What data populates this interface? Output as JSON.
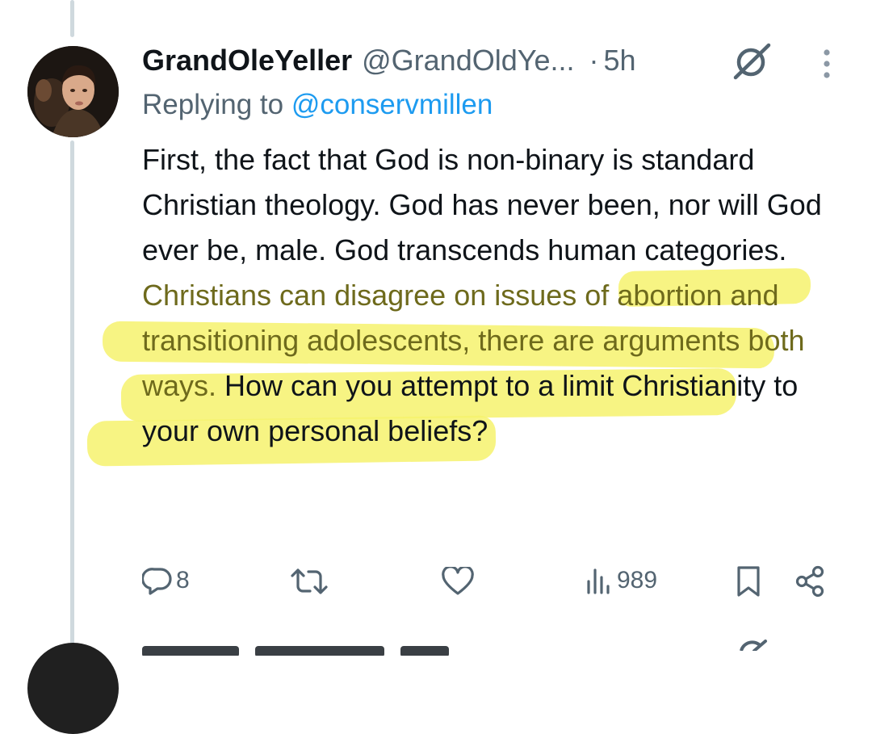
{
  "tweet": {
    "display_name": "GrandOleYeller",
    "handle": "@GrandOldYe...",
    "separator": "·",
    "time": "5h",
    "replying_prefix": "Replying to ",
    "replying_mention": "@conservmillen",
    "body_part1": "First, the fact that God is non-binary is standard Christian theology.  God has never been, nor will God ever be, male.  God transcends human categories.  ",
    "body_highlight": "Christians can disagree on issues of abortion and transitioning adolescents, there are arguments both ways.",
    "body_part2": "  How can you attempt to a limit Christianity to your own personal beliefs?",
    "highlight_color": "#f6f26d"
  },
  "actions": {
    "reply_count": "8",
    "repost_count": "",
    "like_count": "",
    "views_count": "989"
  },
  "colors": {
    "text": "#0f1419",
    "secondary": "#536471",
    "link": "#1d9bf0",
    "thread_line": "#cfd9de"
  },
  "icons": [
    "grok-icon",
    "more-icon",
    "reply-icon",
    "repost-icon",
    "like-icon",
    "views-icon",
    "bookmark-icon",
    "share-icon"
  ]
}
